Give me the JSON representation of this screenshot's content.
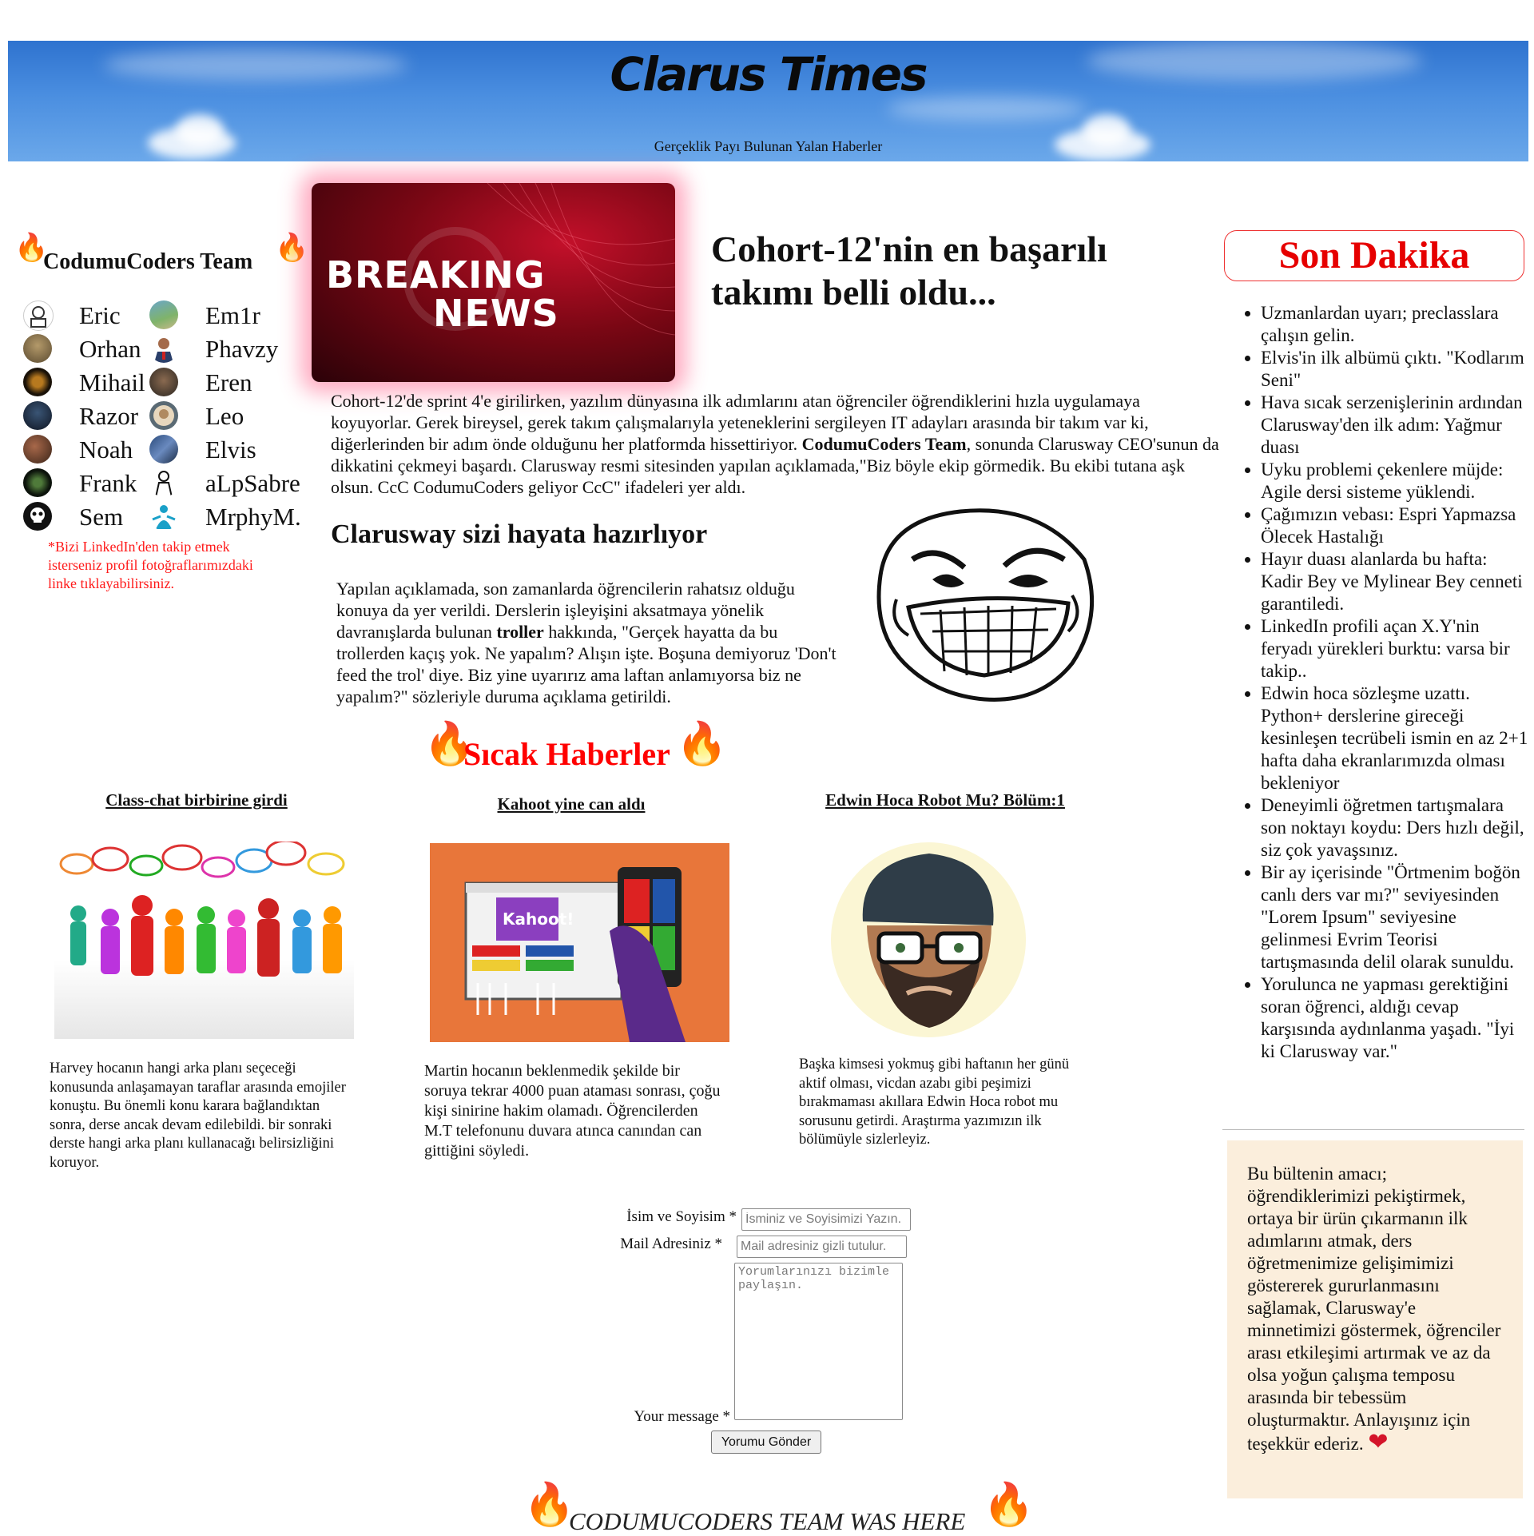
{
  "header": {
    "title": "Clarus Times",
    "tagline": "Gerçeklik Payı Bulunan Yalan Haberler"
  },
  "team": {
    "heading": "CodumuCoders Team",
    "members": [
      "Eric",
      "Em1r",
      "Orhan",
      "Phavzy",
      "Mihail",
      "Eren",
      "Razor",
      "Leo",
      "Noah",
      "Elvis",
      "Frank",
      "aLpSabre",
      "Sem",
      "MrphyM."
    ],
    "note": "*Bizi LinkedIn'den takip etmek isterseniz profil fotoğraflarımızdaki linke tıklayabilirsiniz."
  },
  "main": {
    "image_text_line1": "BREAKING",
    "image_text_line2": "NEWS",
    "headline": "Cohort-12'nin en başarılı takımı belli oldu...",
    "lead_before": "Cohort-12'de sprint 4'e girilirken, yazılım dünyasına ilk adımlarını atan öğrenciler öğrendiklerini hızla uygulamaya koyuyorlar. Gerek bireysel, gerek takım çalışmalarıyla yeteneklerini sergileyen IT adayları arasında bir takım var ki, diğerlerinden bir adım önde olduğunu her platformda hissettiriyor.",
    "lead_bold": "CodumuCoders Team",
    "lead_after": ", sonunda Clarusway CEO'sunun da dikkatini çekmeyi başardı. Clarusway resmi sitesinden yapılan açıklamada,\"Biz böyle ekip görmedik. Bu ekibi tutana aşk olsun. CcC CodumuCoders geliyor CcC\" ifadeleri yer aldı.",
    "sub_headline": "Clarusway sizi hayata hazırlıyor",
    "sub_before": "Yapılan açıklamada, son zamanlarda öğrencilerin rahatsız olduğu konuya da yer verildi. Derslerin işleyişini aksatmaya yönelik davranışlarda bulunan ",
    "sub_bold": "troller",
    "sub_after": " hakkında, \"Gerçek hayatta da bu trollerden kaçış yok. Ne yapalım? Alışın işte. Boşuna demiyoruz 'Don't feed the trol' diye. Biz yine uyarırız ama laftan anlamıyorsa biz ne yapalım?\" sözleriyle duruma açıklama getirildi."
  },
  "hot_news": {
    "heading": "Sıcak Haberler",
    "stories": [
      {
        "title": "Class-chat birbirine girdi",
        "text": "Harvey hocanın hangi arka planı seçeceği konusunda anlaşamayan taraflar arasında emojiler konuştu. Bu önemli konu karara bağlandıktan sonra, derse ancak devam edilebildi. bir sonraki derste hangi arka planı kullanacağı belirsizliğini koruyor."
      },
      {
        "title": "Kahoot yine can aldı",
        "image_logo": "Kahoot!",
        "text": "Martin hocanın beklenmedik şekilde bir soruya tekrar 4000 puan ataması sonrası, çoğu kişi sinirine hakim olamadı. Öğrencilerden M.T telefonunu duvara atınca canından can gittiğini söyledi."
      },
      {
        "title": "Edwin Hoca Robot Mu? Bölüm:1",
        "text": "Başka kimsesi yokmuş gibi haftanın her günü aktif olması, vicdan azabı gibi peşimizi bırakmaması akıllara Edwin Hoca robot mu sorusunu getirdi. Araştırma yazımızın ilk bölümüyle sizlerleyiz."
      }
    ]
  },
  "form": {
    "name_label": "İsim ve Soyisim *",
    "name_placeholder": "İsminiz ve Soyisimizi Yazın.",
    "email_label": "Mail Adresiniz *",
    "email_placeholder": "Mail adresiniz gizli tutulur.",
    "message_label": "Your message *",
    "message_placeholder": "Yorumlarınızı bizimle paylaşın.",
    "submit_label": "Yorumu Gönder"
  },
  "footer": {
    "banner": "CODUMUCODERS TEAM WAS HERE"
  },
  "sidebar_right": {
    "breaking_title": "Son Dakika",
    "news": [
      "Uzmanlardan uyarı; preclasslara çalışın gelin.",
      "Elvis'in ilk albümü çıktı. \"Kodlarım Seni\"",
      "Hava sıcak serzenişlerinin ardından Clarusway'den ilk adım: Yağmur duası",
      "Uyku problemi çekenlere müjde: Agile dersi sisteme yüklendi.",
      "Çağımızın vebası: Espri Yapmazsa Ölecek Hastalığı",
      "Hayır duası alanlarda bu hafta: Kadir Bey ve Mylinear Bey cenneti garantiledi.",
      "LinkedIn profili açan X.Y'nin feryadı yürekleri burktu: varsa bir takip..",
      "Edwin hoca sözleşme uzattı. Python+ derslerine gireceği kesinleşen tecrübeli ismin en az 2+1 hafta daha ekranlarımızda olması bekleniyor",
      "Deneyimli öğretmen tartışmalara son noktayı koydu: Ders hızlı değil, siz çok yavaşsınız.",
      "Bir ay içerisinde \"Örtmenim boğön canlı ders var mı?\" seviyesinden \"Lorem Ipsum\" seviyesine gelinmesi Evrim Teorisi tartışmasında delil olarak sunuldu.",
      "Yorulunca ne yapması gerektiğini soran öğrenci, aldığı cevap karşısında aydınlanma yaşadı. \"İyi ki Clarusway var.\""
    ],
    "purpose": "Bu bültenin amacı; öğrendiklerimizi pekiştirmek, ortaya bir ürün çıkarmanın ilk adımlarını atmak, ders öğretmenimize gelişimimizi göstererek gururlanmasını sağlamak, Clarusway'e minnetimizi göstermek, öğrenciler arası etkileşimi artırmak ve az da olsa yoğun çalışma temposu arasında bir tebessüm oluşturmaktır. Anlayışınız için teşekkür ederiz."
  },
  "icons": {
    "flame": "flame-icon",
    "heart": "heart-icon"
  },
  "colors": {
    "header_sky": "#3a7fd5",
    "breaking_red": "#e60000",
    "note_red": "#ff1a1a",
    "purpose_bg": "#fbeedc"
  }
}
